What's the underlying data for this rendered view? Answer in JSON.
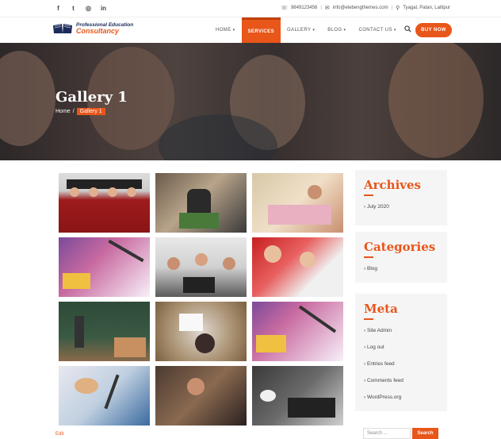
{
  "topbar": {
    "social_icons": [
      "facebook-icon",
      "twitter-icon",
      "instagram-icon",
      "linkedin-icon"
    ],
    "social_glyphs": [
      "f",
      "t",
      "◎",
      "in"
    ],
    "phone": "9849123456",
    "email": "info@elebengthemes.com",
    "location": "Tyagal, Patan, Lalitpur"
  },
  "header": {
    "logo_line1": "Professional Education",
    "logo_line2": "Consultancy",
    "nav": [
      {
        "label": "HOME",
        "dropdown": true
      },
      {
        "label": "SERVICES",
        "dropdown": false,
        "active": true
      },
      {
        "label": "GALLERY",
        "dropdown": true
      },
      {
        "label": "BLOG",
        "dropdown": true
      },
      {
        "label": "CONTACT US",
        "dropdown": true
      }
    ],
    "buy_label": "BUY NOW"
  },
  "hero": {
    "title": "Gallery 1",
    "breadcrumb_home": "Home",
    "breadcrumb_sep": "/",
    "breadcrumb_current": "Gallery 1"
  },
  "gallery": {
    "photos": [
      "graduates-photo",
      "cafe-students-photo",
      "classroom-kids-photo",
      "stationery-flatlay-photo",
      "office-team-photo",
      "kids-drawing-photo",
      "chalkboard-photo",
      "child-reading-photo",
      "pencils-palette-photo",
      "art-supplies-photo",
      "laptop-student-photo",
      "study-desk-photo"
    ]
  },
  "edit_label": "Edit",
  "sidebar": {
    "archives_title": "Archives",
    "archives": [
      "July 2020"
    ],
    "categories_title": "Categories",
    "categories": [
      "Blog"
    ],
    "meta_title": "Meta",
    "meta": [
      "Site Admin",
      "Log out",
      "Entries feed",
      "Comments feed",
      "WordPress.org"
    ],
    "search_placeholder": "Search ...",
    "search_button": "Search"
  },
  "colors": {
    "accent": "#e8561a",
    "navy": "#1c2b5a"
  }
}
